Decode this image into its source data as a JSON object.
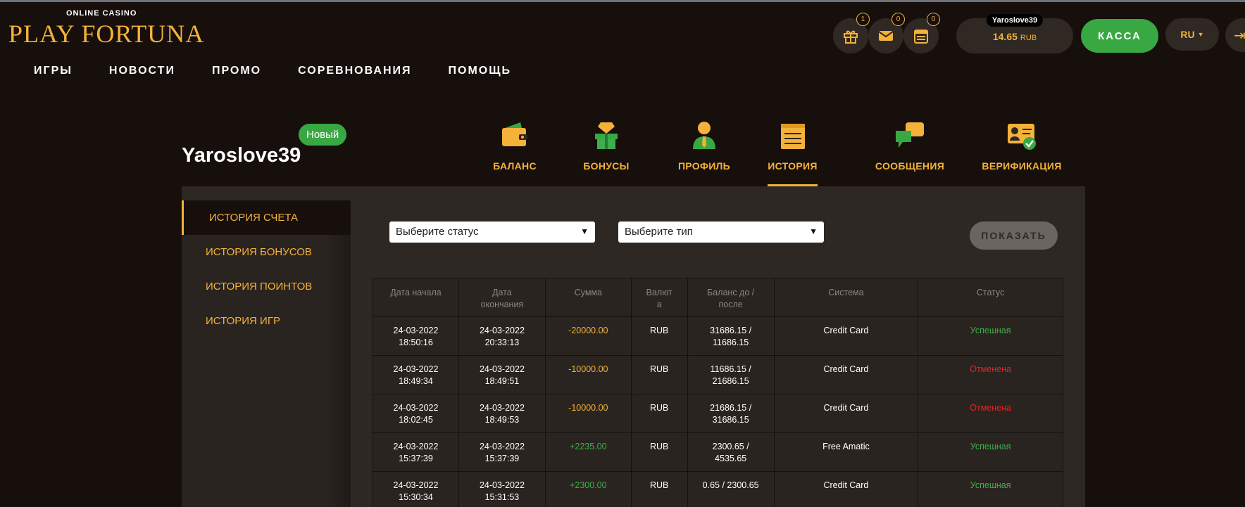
{
  "logo": {
    "sub": "ONLINE CASINO",
    "main": "PLAY FORTUNA"
  },
  "nav": [
    "ИГРЫ",
    "НОВОСТИ",
    "ПРОМО",
    "СОРЕВНОВАНИЯ",
    "ПОМОЩЬ"
  ],
  "header": {
    "gift_count": "1",
    "mail_count": "0",
    "calendar_count": "0",
    "username": "Yaroslove39",
    "balance": "14.65",
    "currency": "RUB",
    "kassa_label": "КАССА",
    "lang": "RU"
  },
  "profile": {
    "username": "Yaroslove39",
    "badge": "Новый",
    "tabs": [
      {
        "label": "БАЛАНС",
        "icon": "wallet-icon"
      },
      {
        "label": "БОНУСЫ",
        "icon": "bonus-gift-icon"
      },
      {
        "label": "ПРОФИЛЬ",
        "icon": "user-profile-icon"
      },
      {
        "label": "ИСТОРИЯ",
        "icon": "history-notepad-icon"
      },
      {
        "label": "СООБЩЕНИЯ",
        "icon": "chat-bubbles-icon"
      },
      {
        "label": "ВЕРИФИКАЦИЯ",
        "icon": "id-card-check-icon"
      }
    ]
  },
  "sidebar": [
    "ИСТОРИЯ СЧЕТА",
    "ИСТОРИЯ БОНУСОВ",
    "ИСТОРИЯ ПОИНТОВ",
    "ИСТОРИЯ ИГР"
  ],
  "filters": {
    "status_placeholder": "Выберите статус",
    "type_placeholder": "Выберите тип",
    "show_label": "ПОКАЗАТЬ"
  },
  "table": {
    "headers": [
      "Дата начала",
      "Дата окончания",
      "Сумма",
      "Валюта",
      "Баланс до / после",
      "Система",
      "Статус"
    ],
    "rows": [
      {
        "start": "24-03-2022 18:50:16",
        "end": "24-03-2022 20:33:13",
        "amount": "-20000.00",
        "currency": "RUB",
        "balance": "31686.15 / 11686.15",
        "system": "Credit Card",
        "status": "Успешная"
      },
      {
        "start": "24-03-2022 18:49:34",
        "end": "24-03-2022 18:49:51",
        "amount": "-10000.00",
        "currency": "RUB",
        "balance": "11686.15 / 21686.15",
        "system": "Credit Card",
        "status": "Отменена"
      },
      {
        "start": "24-03-2022 18:02:45",
        "end": "24-03-2022 18:49:53",
        "amount": "-10000.00",
        "currency": "RUB",
        "balance": "21686.15 / 31686.15",
        "system": "Credit Card",
        "status": "Отменена"
      },
      {
        "start": "24-03-2022 15:37:39",
        "end": "24-03-2022 15:37:39",
        "amount": "+2235.00",
        "currency": "RUB",
        "balance": "2300.65 / 4535.65",
        "system": "Free Amatic",
        "status": "Успешная"
      },
      {
        "start": "24-03-2022 15:30:34",
        "end": "24-03-2022 15:31:53",
        "amount": "+2300.00",
        "currency": "RUB",
        "balance": "0.65 / 2300.65",
        "system": "Credit Card",
        "status": "Успешная"
      }
    ]
  },
  "colors": {
    "accent": "#f4b23a",
    "success": "#3fae4c",
    "cancel": "#e02525",
    "kassa": "#38a843"
  }
}
